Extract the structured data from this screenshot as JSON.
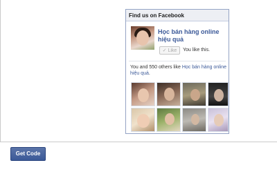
{
  "widget": {
    "header": "Find us on Facebook",
    "page_name": "Học bán hàng online hiệu quả",
    "like_button": "Like",
    "like_status": "You like this.",
    "summary_prefix": "You and 550 others like ",
    "summary_link": "Học bán hàng online hiệu quả",
    "summary_suffix": "."
  },
  "actions": {
    "get_code": "Get Code"
  },
  "colors": {
    "facebook_blue": "#3b5998",
    "header_bg": "#edeff4",
    "button_bg": "#3b5998"
  }
}
